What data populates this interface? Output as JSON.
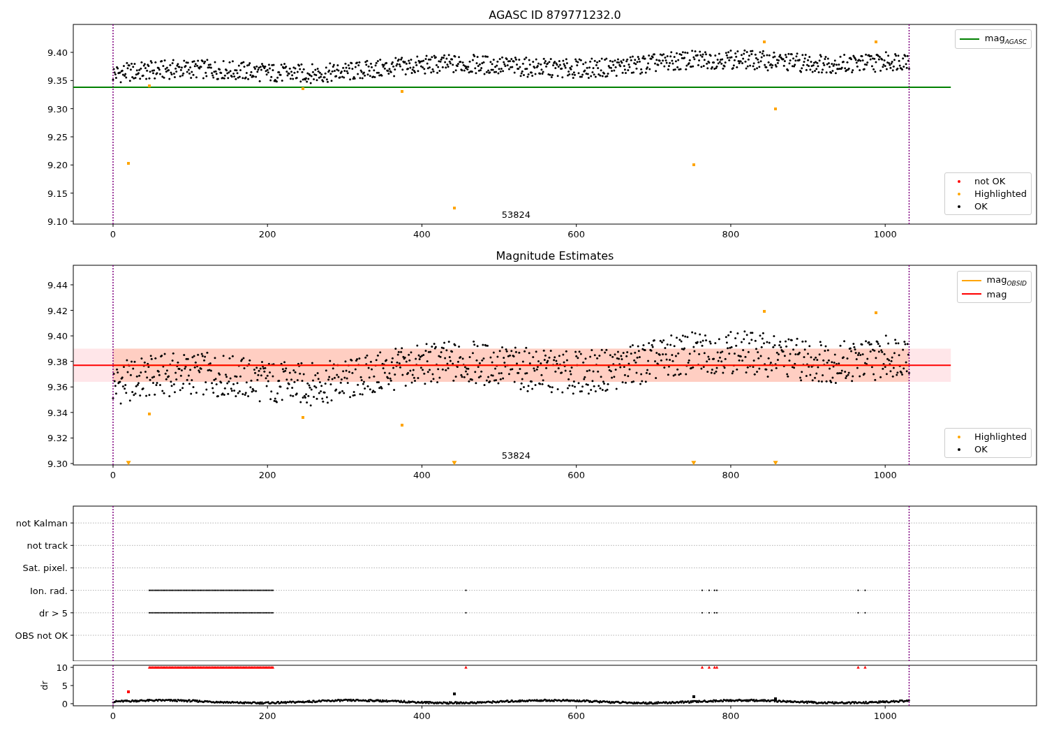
{
  "figure": {
    "panels": [
      {
        "kind": "magnitude",
        "legends": [
          {
            "entries": [
              {
                "label": "mag$_{AGASC}$",
                "kind": "line",
                "color": "#008000"
              }
            ]
          },
          {
            "entries": [
              {
                "label": "not OK",
                "kind": "dot",
                "color": "#ff0000"
              },
              {
                "label": "Highlighted",
                "kind": "dot",
                "color": "#ffa500"
              },
              {
                "label": "OK",
                "kind": "dot",
                "color": "#000000"
              }
            ]
          }
        ],
        "chart_data": {
          "type": "scatter",
          "title": "AGASC ID 879771232.0",
          "xlim": [
            -51.5,
            1196
          ],
          "ylim": [
            9.095,
            9.4496
          ],
          "xticks": [
            0,
            200,
            400,
            600,
            800,
            1000
          ],
          "yticks": [
            {
              "value": 9.1,
              "label": "9.10"
            },
            {
              "value": 9.15,
              "label": "9.15"
            },
            {
              "value": 9.2,
              "label": "9.20"
            },
            {
              "value": 9.25,
              "label": "9.25"
            },
            {
              "value": 9.3,
              "label": "9.30"
            },
            {
              "value": 9.35,
              "label": "9.35"
            },
            {
              "value": 9.4,
              "label": "9.40"
            }
          ],
          "x": [
            20,
            47,
            246,
            374,
            442,
            752,
            843,
            858,
            988
          ],
          "series": [
            {
              "color": "#ffa500",
              "values": [
                9.203,
                9.341,
                9.336,
                9.33,
                9.124,
                9.2,
                9.418,
                9.3,
                9.419
              ]
            }
          ],
          "ref_lines": [
            {
              "axis": "y",
              "value": 9.338,
              "color": "#008000"
            },
            {
              "axis": "x",
              "value": 0,
              "color": "#800080"
            },
            {
              "axis": "x",
              "value": 1031,
              "color": "#800080"
            }
          ],
          "annotations": [
            "53824"
          ]
        }
      },
      {
        "kind": "magnitude",
        "legends": [
          {
            "entries": [
              {
                "label": "mag$_{OBSID}$",
                "kind": "line",
                "color": "#ffa500"
              },
              {
                "label": "mag",
                "kind": "line",
                "color": "#ff0000"
              }
            ]
          },
          {
            "entries": [
              {
                "label": "Highlighted",
                "kind": "dot",
                "color": "#ffa500"
              },
              {
                "label": "OK",
                "kind": "dot",
                "color": "#000000"
              }
            ]
          }
        ],
        "chart_data": {
          "type": "scatter",
          "title": "Magnitude Estimates",
          "xlim": [
            -51.5,
            1196
          ],
          "ylim": [
            9.2989,
            9.4553
          ],
          "xticks": [
            0,
            200,
            400,
            600,
            800,
            1000
          ],
          "yticks": [
            {
              "value": 9.3,
              "label": "9.30"
            },
            {
              "value": 9.32,
              "label": "9.32"
            },
            {
              "value": 9.34,
              "label": "9.34"
            },
            {
              "value": 9.36,
              "label": "9.36"
            },
            {
              "value": 9.38,
              "label": "9.38"
            },
            {
              "value": 9.4,
              "label": "9.40"
            },
            {
              "value": 9.42,
              "label": "9.42"
            },
            {
              "value": 9.44,
              "label": "9.44"
            }
          ],
          "x": [
            20,
            47,
            246,
            374,
            442,
            752,
            843,
            858,
            988
          ],
          "series": [
            {
              "color": "#ffa500",
              "values": [
                null,
                9.339,
                9.336,
                9.33,
                null,
                null,
                9.419,
                null,
                9.418
              ]
            },
            {
              "color": "#ffa500",
              "values": [
                9.301,
                null,
                null,
                null,
                9.301,
                9.301,
                null,
                9.301,
                null
              ]
            }
          ],
          "bands": [
            {
              "axis": "y",
              "from": 9.364,
              "to": 9.39,
              "color": "#ffb6c1"
            },
            {
              "axis": "y",
              "from": 9.364,
              "to": 9.39,
              "color": "#ffa07a"
            }
          ],
          "ref_lines": [
            {
              "axis": "y",
              "value": 9.377,
              "color": "#ffa500"
            },
            {
              "axis": "y",
              "value": 9.377,
              "color": "#ff0000"
            },
            {
              "axis": "x",
              "value": 0,
              "color": "#800080"
            },
            {
              "axis": "x",
              "value": 1031,
              "color": "#800080"
            }
          ],
          "annotations": [
            "53824"
          ]
        }
      },
      {
        "kind": "flags",
        "rows": [
          {
            "label": "not Kalman",
            "flagged": false
          },
          {
            "label": "not track",
            "flagged": false
          },
          {
            "label": "Sat. pixel.",
            "flagged": false
          },
          {
            "label": "Ion. rad.",
            "flagged": true
          },
          {
            "label": "dr > 5",
            "flagged": true
          },
          {
            "label": "OBS not OK",
            "flagged": false
          }
        ]
      },
      {
        "kind": "dr",
        "chart_data": {
          "type": "scatter",
          "ylabel": "dr",
          "xlim": [
            -51.5,
            1196
          ],
          "ylim": [
            -0.58,
            10.58
          ],
          "xticks": [
            0,
            200,
            400,
            600,
            800,
            1000
          ],
          "yticks": [
            0,
            5,
            10
          ],
          "x": [
            20,
            442,
            752,
            858,
            47,
            49,
            51,
            53,
            55,
            57,
            59,
            61,
            63,
            65,
            67,
            69,
            71,
            73,
            75,
            77,
            79,
            81,
            83,
            85,
            87,
            89,
            91,
            93,
            95,
            97,
            99,
            101,
            103,
            105,
            107,
            109,
            111,
            113,
            115,
            117,
            119,
            121,
            123,
            125,
            127,
            129,
            131,
            133,
            135,
            137,
            139,
            141,
            143,
            145,
            147,
            149,
            151,
            153,
            155,
            157,
            159,
            161,
            163,
            165,
            167,
            169,
            171,
            173,
            175,
            177,
            179,
            181,
            183,
            185,
            187,
            189,
            191,
            193,
            195,
            197,
            199,
            201,
            203,
            205,
            207,
            457,
            763,
            772,
            779,
            782,
            965,
            974
          ],
          "series": [
            {
              "color": "#ff0000",
              "values": [
                null,
                null,
                null,
                null,
                10,
                10,
                10,
                10,
                10,
                10,
                10,
                10,
                10,
                10,
                10,
                10,
                10,
                10,
                10,
                10,
                10,
                10,
                10,
                10,
                10,
                10,
                10,
                10,
                10,
                10,
                10,
                10,
                10,
                10,
                10,
                10,
                10,
                10,
                10,
                10,
                10,
                10,
                10,
                10,
                10,
                10,
                10,
                10,
                10,
                10,
                10,
                10,
                10,
                10,
                10,
                10,
                10,
                10,
                10,
                10,
                10,
                10,
                10,
                10,
                10,
                10,
                10,
                10,
                10,
                10,
                10,
                10,
                10,
                10,
                10,
                10,
                10,
                10,
                10,
                10,
                10,
                10,
                10,
                10,
                10,
                10,
                10,
                10,
                10,
                10,
                10,
                10
              ]
            },
            {
              "color": "#ff0000",
              "values": [
                3.2,
                null,
                null,
                null,
                null,
                null,
                null,
                null,
                null,
                null,
                null,
                null,
                null,
                null,
                null,
                null,
                null,
                null,
                null,
                null,
                null,
                null,
                null,
                null,
                null,
                null,
                null,
                null,
                null,
                null,
                null,
                null,
                null,
                null,
                null,
                null,
                null,
                null,
                null,
                null,
                null,
                null,
                null,
                null,
                null,
                null,
                null,
                null,
                null,
                null,
                null,
                null,
                null,
                null,
                null,
                null,
                null,
                null,
                null,
                null,
                null,
                null,
                null,
                null,
                null,
                null,
                null,
                null,
                null,
                null,
                null,
                null,
                null,
                null,
                null,
                null,
                null,
                null,
                null,
                null,
                null,
                null,
                null,
                null,
                null,
                null,
                null,
                null,
                null,
                null,
                null,
                null
              ]
            },
            {
              "color": "#000000",
              "values": [
                null,
                2.7,
                2.0,
                1.3,
                null,
                null,
                null,
                null,
                null,
                null,
                null,
                null,
                null,
                null,
                null,
                null,
                null,
                null,
                null,
                null,
                null,
                null,
                null,
                null,
                null,
                null,
                null,
                null,
                null,
                null,
                null,
                null,
                null,
                null,
                null,
                null,
                null,
                null,
                null,
                null,
                null,
                null,
                null,
                null,
                null,
                null,
                null,
                null,
                null,
                null,
                null,
                null,
                null,
                null,
                null,
                null,
                null,
                null,
                null,
                null,
                null,
                null,
                null,
                null,
                null,
                null,
                null,
                null,
                null,
                null,
                null,
                null,
                null,
                null,
                null,
                null,
                null,
                null,
                null,
                null,
                null,
                null,
                null,
                null,
                null,
                null,
                null,
                null,
                null,
                null,
                null,
                null
              ]
            }
          ],
          "ref_lines": [
            {
              "axis": "x",
              "value": 0,
              "color": "#800080"
            },
            {
              "axis": "x",
              "value": 1031,
              "color": "#800080"
            }
          ]
        }
      }
    ]
  }
}
